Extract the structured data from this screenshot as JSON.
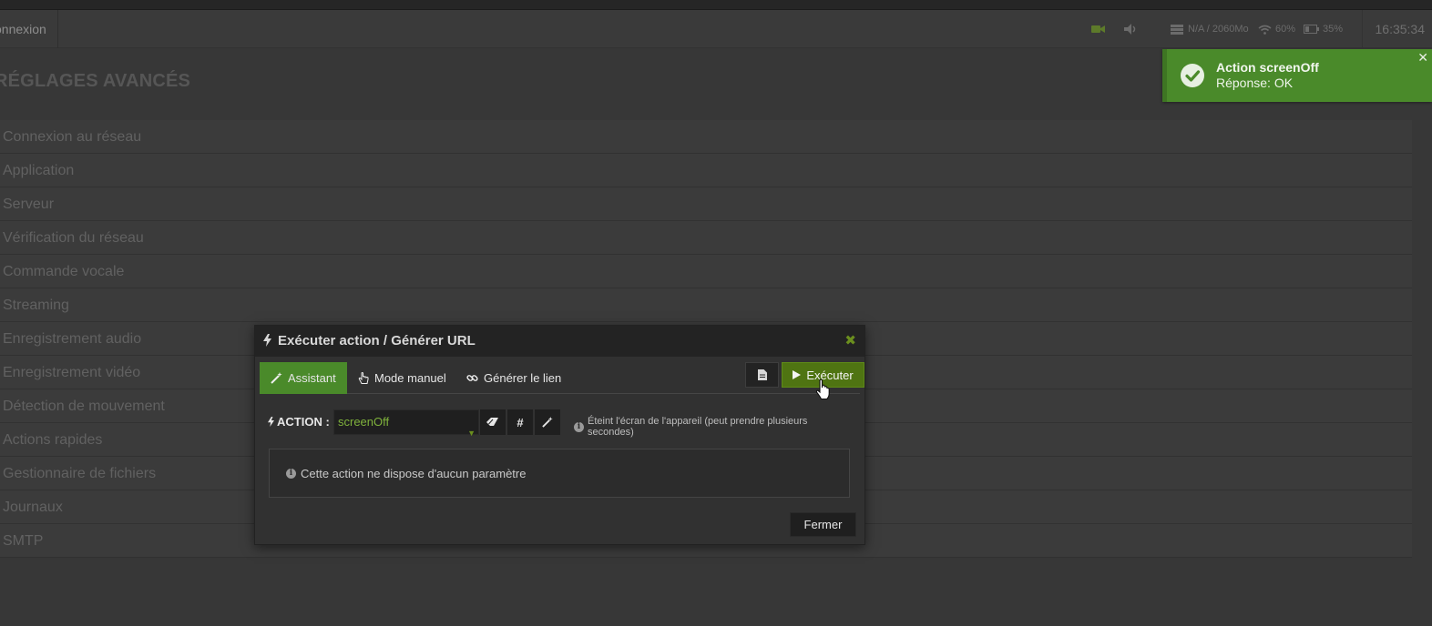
{
  "topbar": {
    "tab_label": "onnexion",
    "memory": "N/A / 2060Mo",
    "wifi": "60%",
    "battery": "35%",
    "clock": "16:35:34"
  },
  "page": {
    "title": "RÉGLAGES AVANCÉS"
  },
  "menu": {
    "items": [
      "Connexion au réseau",
      "Application",
      "Serveur",
      "Vérification du réseau",
      "Commande vocale",
      "Streaming",
      "Enregistrement audio",
      "Enregistrement vidéo",
      "Détection de mouvement",
      "Actions rapides",
      "Gestionnaire de fichiers",
      "Journaux",
      "SMTP"
    ]
  },
  "toast": {
    "title": "Action screenOff",
    "message": "Réponse: OK",
    "color": "#4a8a2a"
  },
  "modal": {
    "title": "Exécuter action / Générer URL",
    "tabs": {
      "assistant": "Assistant",
      "manual": "Mode manuel",
      "link": "Générer le lien"
    },
    "execute_label": "Exécuter",
    "action_label": "ACTION :",
    "action_value": "screenOff",
    "action_info": "Éteint l'écran de l'appareil (peut prendre plusieurs secondes)",
    "params_text": "Cette action ne dispose d'aucun paramètre",
    "close_label": "Fermer",
    "accent": "#4a8a2a"
  }
}
